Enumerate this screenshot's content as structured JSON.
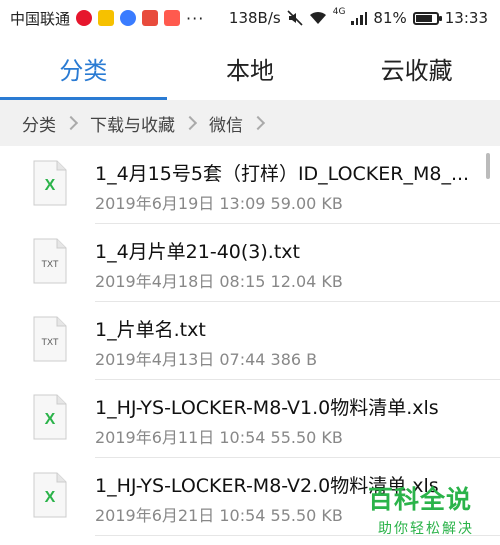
{
  "status_bar": {
    "carrier": "中国联通",
    "net_speed": "138B/s",
    "network_type": "4G",
    "battery_text": "81%",
    "battery_level": 0.81,
    "time": "13:33",
    "app_icons": [
      "weibo-icon",
      "yellow-app-icon",
      "baidu-icon",
      "red-app-icon",
      "red-app-icon-2"
    ]
  },
  "tabs": [
    {
      "label": "分类",
      "active": true
    },
    {
      "label": "本地",
      "active": false
    },
    {
      "label": "云收藏",
      "active": false
    }
  ],
  "breadcrumb": [
    "分类",
    "下载与收藏",
    "微信"
  ],
  "files": [
    {
      "type": "xls",
      "name": "1_4月15号5套（打样）ID_LOCKER_M8_...",
      "meta": "2019年6月19日 13:09 59.00 KB"
    },
    {
      "type": "txt",
      "name": "1_4月片单21-40(3).txt",
      "meta": "2019年4月18日 08:15 12.04 KB"
    },
    {
      "type": "txt",
      "name": "1_片单名.txt",
      "meta": "2019年4月13日 07:44 386 B"
    },
    {
      "type": "xls",
      "name": "1_HJ-YS-LOCKER-M8-V1.0物料清单.xls",
      "meta": "2019年6月11日 10:54 55.50 KB"
    },
    {
      "type": "xls",
      "name": "1_HJ-YS-LOCKER-M8-V2.0物料清单.xls",
      "meta": "2019年6月21日 10:54 55.50 KB"
    }
  ],
  "icons": {
    "xls_label": "X",
    "txt_label": "TXT"
  },
  "colors": {
    "accent": "#2a7bd3",
    "xls_green": "#2bb34a",
    "watermark_green": "#2bb34a"
  },
  "watermark": {
    "title": "百科全说",
    "subtitle": "助你轻松解决"
  }
}
